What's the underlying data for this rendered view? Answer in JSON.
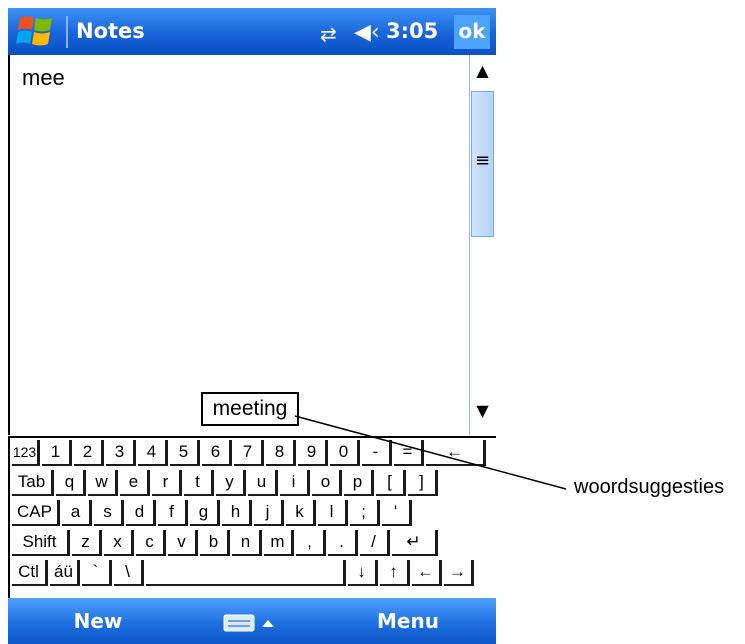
{
  "titlebar": {
    "app_title": "Notes",
    "clock": "3:05",
    "ok_label": "ok",
    "icons": [
      "windows-start-icon",
      "connectivity-icon",
      "speaker-icon"
    ],
    "colors": {
      "bar": "#1864d8",
      "ok": "#4ca3ff"
    }
  },
  "note": {
    "text": "mee"
  },
  "suggestion": {
    "word": "meeting"
  },
  "keyboard": {
    "rows": [
      [
        "123",
        "1",
        "2",
        "3",
        "4",
        "5",
        "6",
        "7",
        "8",
        "9",
        "0",
        "-",
        "=",
        "←"
      ],
      [
        "Tab",
        "q",
        "w",
        "e",
        "r",
        "t",
        "y",
        "u",
        "i",
        "o",
        "p",
        "[",
        "]"
      ],
      [
        "CAP",
        "a",
        "s",
        "d",
        "f",
        "g",
        "h",
        "j",
        "k",
        "l",
        ";",
        "'"
      ],
      [
        "Shift",
        "z",
        "x",
        "c",
        "v",
        "b",
        "n",
        "m",
        ",",
        ".",
        "/",
        "↵"
      ],
      [
        "Ctl",
        "áü",
        "`",
        "\\",
        " ",
        "↓",
        "↑",
        "←",
        "→"
      ]
    ]
  },
  "menubar": {
    "new_label": "New",
    "menu_label": "Menu",
    "sip_icon": "keyboard-icon"
  },
  "annotation": {
    "label": "woordsuggesties"
  }
}
